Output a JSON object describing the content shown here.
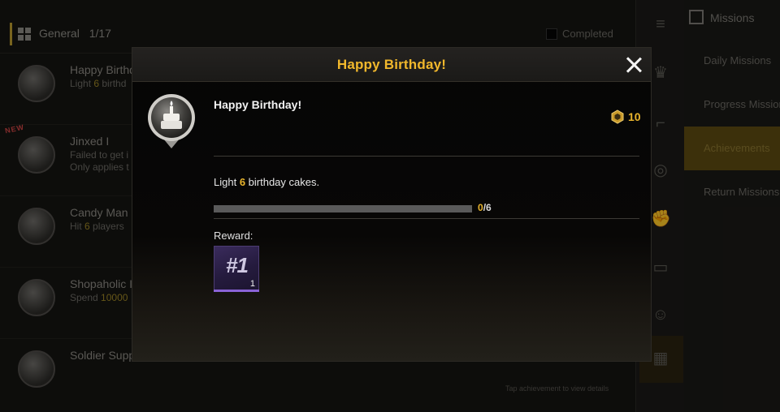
{
  "background": {
    "category_label": "General",
    "category_count": "1/17",
    "completed_label": "Completed",
    "new_badge": "NEW",
    "achievements": [
      {
        "title": "Happy Birthd",
        "desc_pre": "Light ",
        "desc_num": "6",
        "desc_post": " birthd",
        "desc2": ""
      },
      {
        "title": "Jinxed I",
        "desc_pre": "Failed to get i",
        "desc_num": "",
        "desc_post": "",
        "desc2": "Only applies t"
      },
      {
        "title": "Candy Man",
        "desc_pre": "Hit ",
        "desc_num": "6",
        "desc_post": " players",
        "desc2": ""
      },
      {
        "title": "Shopaholic I",
        "desc_pre": "Spend ",
        "desc_num": "10000",
        "desc_post": "",
        "desc2": ""
      },
      {
        "title": "Soldier Supplies I",
        "desc_pre": "",
        "desc_num": "",
        "desc_post": "",
        "desc2": ""
      }
    ],
    "side_header": "Missions",
    "side_items": [
      "Daily Missions",
      "Progress Missions",
      "Achievements",
      "Return Missions"
    ],
    "hint": "Tap achievement to view details"
  },
  "modal": {
    "title": "Happy Birthday!",
    "achievement_name": "Happy Birthday!",
    "points": "10",
    "desc_pre": "Light ",
    "desc_num": "6",
    "desc_post": " birthday cakes.",
    "progress_current": "0",
    "progress_total": "/6",
    "progress_fraction": 0,
    "reward_label": "Reward:",
    "reward_item": "#1",
    "reward_qty": "1"
  },
  "colors": {
    "accent_gold": "#e9b42c",
    "reward_purple": "#3a2b5c"
  },
  "icons": [
    "grid-icon",
    "cake-medal-icon",
    "points-coin-icon",
    "close-icon",
    "menu-icon"
  ]
}
